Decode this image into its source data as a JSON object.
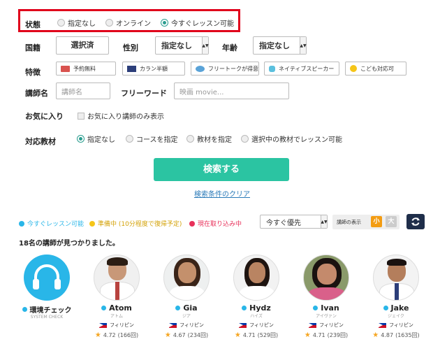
{
  "filters": {
    "status": {
      "label": "状態",
      "options": [
        "指定なし",
        "オンライン",
        "今すぐレッスン可能"
      ],
      "selected": "今すぐレッスン可能"
    },
    "nationality": {
      "label": "国籍",
      "button": "選択済"
    },
    "gender": {
      "label": "性別",
      "value": "指定なし"
    },
    "age": {
      "label": "年齢",
      "value": "指定なし"
    },
    "features": {
      "label": "特徴",
      "items": [
        "予約無料",
        "カラン半額",
        "フリートークが得意",
        "ネイティブスピーカー",
        "こども対応可"
      ]
    },
    "teacher_name": {
      "label": "講師名",
      "placeholder": "講師名"
    },
    "freeword": {
      "label": "フリーワード",
      "placeholder": "映画 movie..."
    },
    "favorites": {
      "label": "お気に入り",
      "checkbox": "お気に入り講師のみ表示"
    },
    "material": {
      "label": "対応教材",
      "options": [
        "指定なし",
        "コースを指定",
        "教材を指定",
        "選択中の教材でレッスン可能"
      ],
      "selected": "指定なし"
    }
  },
  "actions": {
    "search": "検索する",
    "clear": "検索条件のクリア"
  },
  "legend": [
    {
      "label": "今すぐレッスン可能",
      "color": "#29b6e8"
    },
    {
      "label": "準備中 (10分程度で復帰予定)",
      "color": "#f5c518"
    },
    {
      "label": "現在取り込み中",
      "color": "#e8305a"
    }
  ],
  "sort": {
    "value": "今すぐ優先"
  },
  "display": {
    "label": "講師の表示",
    "small": "小",
    "large": "大"
  },
  "result_count": "18名の講師が見つかりました。",
  "colors": {
    "accent": "#2bc4a2",
    "highlight": "#e0001b",
    "online": "#29b6e8",
    "small_active": "#f39c12"
  },
  "env_check": {
    "name": "環境チェック",
    "sub": "SYSTEM CHECK"
  },
  "teachers": [
    {
      "name": "Atom",
      "kana": "アトム",
      "country": "フィリピン",
      "rating": "4.72",
      "count": "(166回)"
    },
    {
      "name": "Gia",
      "kana": "ジア",
      "country": "フィリピン",
      "rating": "4.67",
      "count": "(234回)"
    },
    {
      "name": "Hydz",
      "kana": "ハイズ",
      "country": "フィリピン",
      "rating": "4.71",
      "count": "(529回)"
    },
    {
      "name": "Ivan",
      "kana": "アイヴァン",
      "country": "フィリピン",
      "rating": "4.71",
      "count": "(239回)"
    },
    {
      "name": "Jake",
      "kana": "ジェイク",
      "country": "フィリピン",
      "rating": "4.87",
      "count": "(1635回)"
    }
  ]
}
